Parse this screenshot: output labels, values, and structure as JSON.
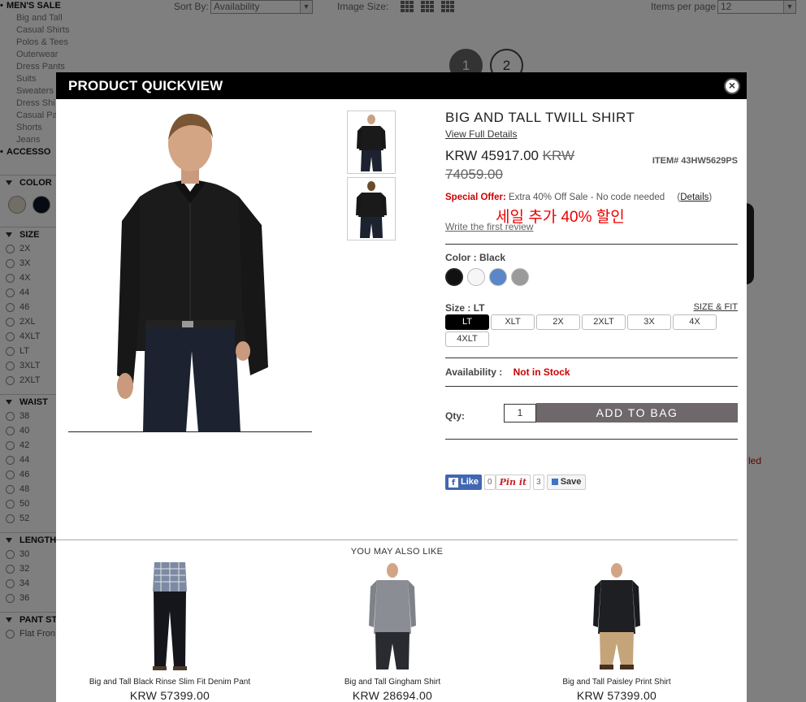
{
  "background": {
    "nav": {
      "title": "MEN'S SALE",
      "items": [
        "Big and Tall",
        "Casual Shirts",
        "Polos & Tees",
        "Outerwear",
        "Dress Pants",
        "Suits",
        "Sweaters",
        "Dress Shi",
        "Casual Pa",
        "Shorts",
        "Jeans"
      ],
      "accessories": "ACCESSO"
    },
    "facets": {
      "color": "COLOR",
      "color_swatches": [
        "#e3dccb",
        "#0c1524"
      ],
      "size": "SIZE",
      "size_opts": [
        "2X",
        "3X",
        "4X",
        "44",
        "46",
        "2XL",
        "4XLT",
        "LT",
        "3XLT",
        "2XLT"
      ],
      "waist": "WAIST",
      "waist_opts": [
        "38",
        "40",
        "42",
        "44",
        "46",
        "48",
        "50",
        "52"
      ],
      "length": "LENGTH",
      "length_opts": [
        "30",
        "32",
        "34",
        "36"
      ],
      "pant": "PANT ST",
      "pant_opts": [
        "Flat Fron"
      ]
    },
    "toolbar": {
      "sort_label": "Sort By:",
      "sort_value": "Availability",
      "image_size_label": "Image Size:",
      "per_page_label": "Items per page",
      "per_page_value": "12"
    },
    "pager": [
      "1",
      "2"
    ],
    "bg_text": "led"
  },
  "modal": {
    "header": "PRODUCT QUICKVIEW",
    "close": "×",
    "title": "BIG AND TALL TWILL SHIRT",
    "view_full": "View Full Details",
    "price_now": "KRW 45917.00",
    "price_old": "KRW 74059.00",
    "item_no": "ITEM# 43HW5629PS",
    "offer_label": "Special Offer:",
    "offer_text": "Extra 40% Off Sale - No code needed",
    "details_link": "Details",
    "korean": "세일 추가 40% 할인",
    "review": "Write the first review",
    "color_label": "Color :",
    "color_value": "Black",
    "swatches": [
      "#111111",
      "#f6f6f6",
      "#5b86c9",
      "#9a9a9a"
    ],
    "size_label": "Size :",
    "size_value": "LT",
    "size_fit": "SIZE & FIT",
    "sizes": [
      "LT",
      "XLT",
      "2X",
      "2XLT",
      "3X",
      "4X",
      "4XLT"
    ],
    "availability_label": "Availability :",
    "availability_value": "Not in Stock",
    "qty_label": "Qty:",
    "qty_value": "1",
    "add_to_bag": "ADD TO BAG",
    "social": {
      "like": "Like",
      "like_count": "0",
      "pin": "Pin it",
      "pin_count": "3",
      "save": "Save"
    },
    "also_title": "YOU MAY ALSO LIKE",
    "recommendations": [
      {
        "name": "Big and Tall Black Rinse Slim Fit Denim Pant",
        "price": "KRW 57399.00"
      },
      {
        "name": "Big and Tall Gingham Shirt",
        "price": "KRW 28694.00"
      },
      {
        "name": "Big and Tall Paisley Print Shirt",
        "price": "KRW 57399.00"
      }
    ]
  }
}
